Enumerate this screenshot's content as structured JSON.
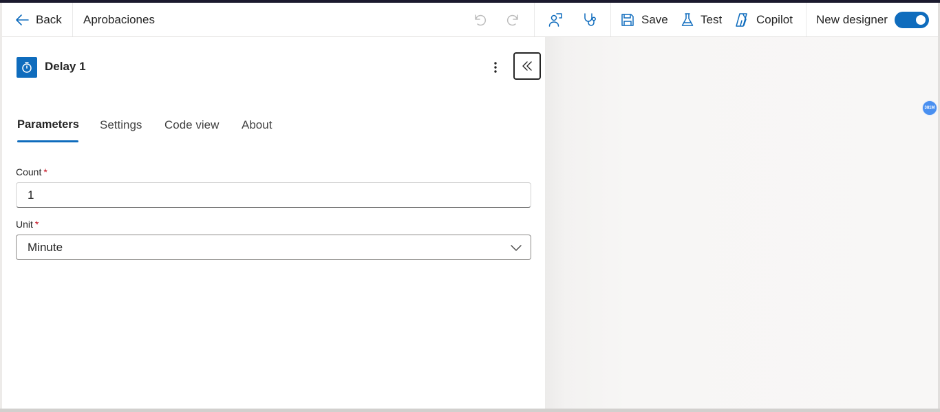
{
  "toolbar": {
    "back_label": "Back",
    "flow_name": "Aprobaciones",
    "save_label": "Save",
    "test_label": "Test",
    "copilot_label": "Copilot",
    "new_designer_label": "New designer",
    "new_designer_enabled": true
  },
  "panel": {
    "action_title": "Delay 1",
    "tabs": [
      {
        "label": "Parameters",
        "active": true
      },
      {
        "label": "Settings",
        "active": false
      },
      {
        "label": "Code view",
        "active": false
      },
      {
        "label": "About",
        "active": false
      }
    ],
    "fields": {
      "count": {
        "label": "Count",
        "required_mark": "*",
        "value": "1"
      },
      "unit": {
        "label": "Unit",
        "required_mark": "*",
        "value": "Minute"
      }
    }
  },
  "canvas": {
    "badge_text": "381M"
  },
  "colors": {
    "accent": "#0f6cbd",
    "required": "#c50f1f",
    "top_stripe": "#1b1a2e"
  },
  "icons": [
    "arrow-left-icon",
    "undo-icon",
    "redo-icon",
    "flow-checker-icon",
    "stethoscope-icon",
    "save-icon",
    "beaker-icon",
    "copilot-icon",
    "timer-icon",
    "more-vertical-icon",
    "double-chevron-left-icon",
    "chevron-down-icon"
  ]
}
